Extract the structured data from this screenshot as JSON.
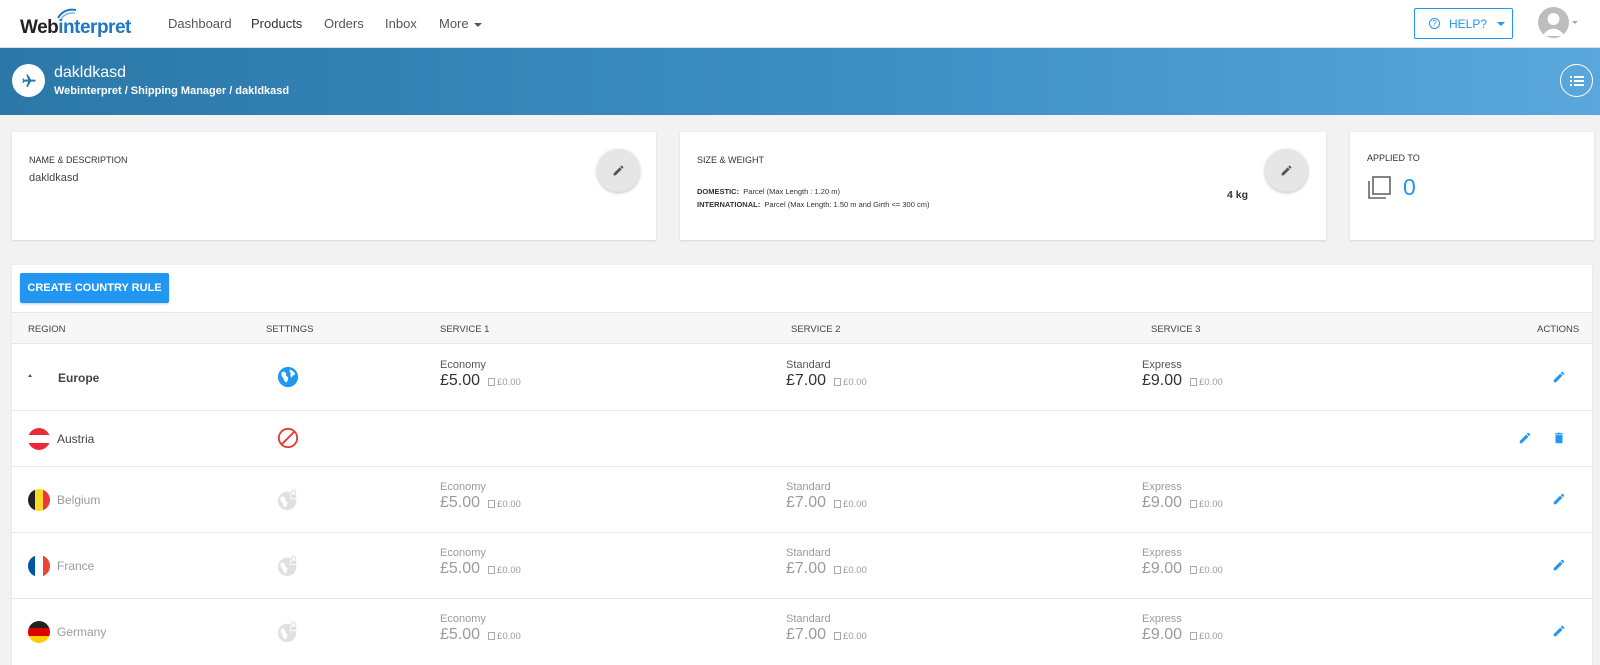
{
  "nav": {
    "logo_prefix": "Web",
    "logo_suffix": "interpret",
    "items": [
      {
        "label": "Dashboard"
      },
      {
        "label": "Products"
      },
      {
        "label": "Orders"
      },
      {
        "label": "Inbox"
      },
      {
        "label": "More"
      }
    ],
    "help_label": "HELP?"
  },
  "header": {
    "title": "dakldkasd",
    "breadcrumb": "Webinterpret / Shipping Manager / dakldkasd"
  },
  "cards": {
    "name": {
      "label": "NAME & DESCRIPTION",
      "value": "dakldkasd"
    },
    "size": {
      "label": "SIZE & WEIGHT",
      "domestic_label": "DOMESTIC:",
      "domestic_value": "Parcel (Max Length : 1.20 m)",
      "international_label": "INTERNATIONAL:",
      "international_value": "Parcel (Max Length: 1.50 m and Girth <= 300 cm)",
      "weight": "4 kg"
    },
    "applied": {
      "label": "APPLIED TO",
      "count": "0"
    }
  },
  "table": {
    "create_button": "CREATE COUNTRY RULE",
    "headers": {
      "region": "REGION",
      "settings": "SETTINGS",
      "service1": "SERVICE 1",
      "service2": "SERVICE 2",
      "service3": "SERVICE 3",
      "actions": "ACTIONS"
    },
    "rows": [
      {
        "name": "Europe",
        "settings_icon": "globe-icon",
        "s1": {
          "name": "Economy",
          "price": "£5.00",
          "extra": "£0.00"
        },
        "s2": {
          "name": "Standard",
          "price": "£7.00",
          "extra": "£0.00"
        },
        "s3": {
          "name": "Express",
          "price": "£9.00",
          "extra": "£0.00"
        }
      },
      {
        "name": "Austria",
        "settings_icon": "blocked-icon"
      },
      {
        "name": "Belgium",
        "settings_icon": "globe-lock-icon",
        "s1": {
          "name": "Economy",
          "price": "£5.00",
          "extra": "£0.00"
        },
        "s2": {
          "name": "Standard",
          "price": "£7.00",
          "extra": "£0.00"
        },
        "s3": {
          "name": "Express",
          "price": "£9.00",
          "extra": "£0.00"
        }
      },
      {
        "name": "France",
        "settings_icon": "globe-lock-icon",
        "s1": {
          "name": "Economy",
          "price": "£5.00",
          "extra": "£0.00"
        },
        "s2": {
          "name": "Standard",
          "price": "£7.00",
          "extra": "£0.00"
        },
        "s3": {
          "name": "Express",
          "price": "£9.00",
          "extra": "£0.00"
        }
      },
      {
        "name": "Germany",
        "settings_icon": "globe-lock-icon",
        "s1": {
          "name": "Economy",
          "price": "£5.00",
          "extra": "£0.00"
        },
        "s2": {
          "name": "Standard",
          "price": "£7.00",
          "extra": "£0.00"
        },
        "s3": {
          "name": "Express",
          "price": "£9.00",
          "extra": "£0.00"
        }
      }
    ]
  },
  "colors": {
    "accent": "#2196f3",
    "header_start": "#2b78a8",
    "header_end": "#5aa7dc",
    "blocked": "#e53935"
  }
}
